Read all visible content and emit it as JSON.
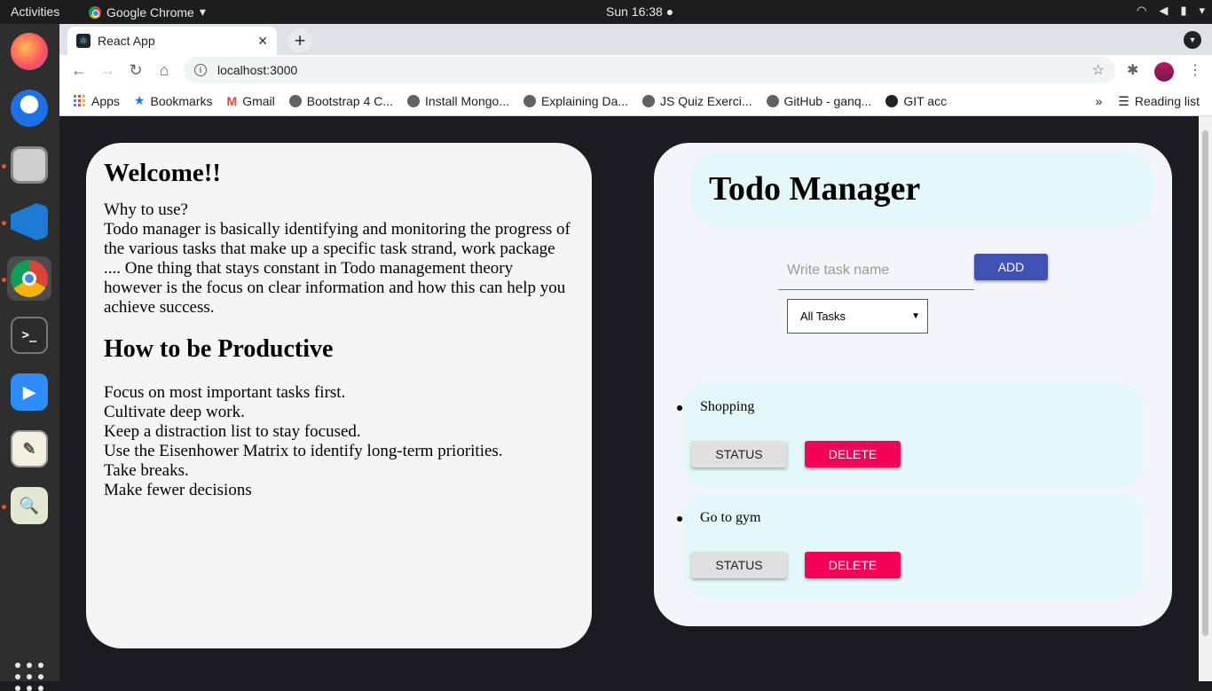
{
  "topbar": {
    "activities": "Activities",
    "app_name": "Google Chrome",
    "clock": "Sun 16:38"
  },
  "dock": {
    "items": [
      "firefox-icon",
      "thunderbird-icon",
      "files-icon",
      "vscode-icon",
      "chrome-icon",
      "terminal-icon",
      "zoom-icon",
      "text-editor-icon",
      "image-viewer-icon"
    ]
  },
  "browser": {
    "tab_title": "React App",
    "url": "localhost:3000",
    "bookmarks": [
      "Apps",
      "Bookmarks",
      "Gmail",
      "Bootstrap 4 C...",
      "Install Mongo...",
      "Explaining Da...",
      "JS Quiz Exerci...",
      "GitHub - ganq...",
      "GIT acc"
    ],
    "more_label": "»",
    "reading_list": "Reading list"
  },
  "left_card": {
    "welcome": "Welcome!!",
    "why_heading": "Why to use?",
    "why_text": "Todo manager is basically identifying and monitoring the progress of the various tasks that make up a specific task strand, work package .... One thing that stays constant in Todo management theory however is the focus on clear information and how this can help you achieve success.",
    "productive_heading": "How to be Productive",
    "tips": [
      "Focus on most important tasks first.",
      "Cultivate deep work.",
      "Keep a distraction list to stay focused.",
      "Use the Eisenhower Matrix to identify long-term priorities.",
      "Take breaks.",
      "Make fewer decisions"
    ]
  },
  "todo_manager": {
    "title": "Todo Manager",
    "input_placeholder": "Write task name",
    "input_value": "",
    "add_label": "ADD",
    "filter_selected": "All Tasks",
    "todos": [
      {
        "name": "Shopping",
        "status_label": "STATUS",
        "delete_label": "DELETE"
      },
      {
        "name": "Go to gym",
        "status_label": "STATUS",
        "delete_label": "DELETE"
      }
    ]
  },
  "colors": {
    "add_button": "#3f51b5",
    "delete_button": "#f50057",
    "todo_card": "#e4f8fa",
    "page_bg": "#1c1b22"
  }
}
